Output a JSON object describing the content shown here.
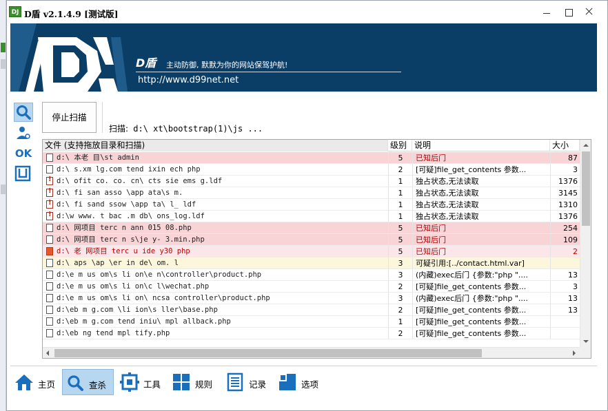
{
  "window": {
    "app_icon_text": "DJ",
    "title": "D盾 v2.1.4.9 [测试版]"
  },
  "banner": {
    "brand": "D盾",
    "slogan": "主动防御, 默默为你的网站保驾护航!",
    "url": "http://www.d99net.net"
  },
  "left_tools": {
    "ok_label": "OK"
  },
  "scan": {
    "stop_button": "停止扫描",
    "label": "扫描:",
    "path": "d:\\                      xt\\bootstrap(1)\\js ..."
  },
  "file_list": {
    "columns": {
      "file": "文件 (支持拖放目录和扫描)",
      "level": "级别",
      "desc": "说明",
      "size": "大小"
    },
    "rows": [
      {
        "style": "red",
        "icon": "file",
        "path": "d:\\   本老     目\\st         admin   ",
        "level": "5",
        "desc": "已知后门",
        "size": "87"
      },
      {
        "style": "white",
        "icon": "file",
        "path": "d:\\   s.xm      lg.com  tend   ixin  ech  php",
        "level": "2",
        "desc": "[可疑]file_get_contents 参数...",
        "size": "3"
      },
      {
        "style": "white",
        "icon": "warn",
        "path": "d:\\   ofit   co.  co.  cn\\  cts  sie   ems   g.ldf",
        "level": "1",
        "desc": "独占状态,无法读取",
        "size": "1376"
      },
      {
        "style": "white",
        "icon": "warn",
        "path": "d:\\   fi   san    asso  \\app   ata\\s  m.",
        "level": "1",
        "desc": "独占状态,无法读取",
        "size": "3145"
      },
      {
        "style": "white",
        "icon": "warn",
        "path": "d:\\   fi   sand   ssow  \\app   ta\\    l_   ldf",
        "level": "1",
        "desc": "独占状态,无法读取",
        "size": "1310"
      },
      {
        "style": "white",
        "icon": "warn",
        "path": "d:\\w      www. t   bac  .m   db\\    ons_log.ldf",
        "level": "1",
        "desc": "独占状态,无法读取",
        "size": "1376"
      },
      {
        "style": "red",
        "icon": "file",
        "path": "d:\\   网项目   terc    n   ann   015   08.php",
        "level": "5",
        "desc": "已知后门",
        "size": "254"
      },
      {
        "style": "red",
        "icon": "file",
        "path": "d:\\   网项目   terc    n  s\\je   y-   3.min.php",
        "level": "5",
        "desc": "已知后门",
        "size": "109"
      },
      {
        "style": "selred",
        "icon": "hot",
        "path": "d:\\   老   网项目   terc   u  ide   y30  php",
        "level": "5",
        "desc": "已知后门",
        "size": "2"
      },
      {
        "style": "yellow",
        "icon": "file",
        "path": "d:\\    aps   \\ap   \\er    in   de\\   om.  l",
        "level": "3",
        "desc": "可疑引用:[../contact.html.var]",
        "size": ""
      },
      {
        "style": "white",
        "icon": "file",
        "path": "d:\\e   m     us    om\\s    li    on\\e   n\\controller\\product.php",
        "level": "3",
        "desc": "(内藏)exec后门 {参数:\"php \"....",
        "size": "13"
      },
      {
        "style": "white",
        "icon": "file",
        "path": "d:\\e   m     us    om\\s    li    on\\c     l\\wechat.php",
        "level": "2",
        "desc": "[可疑]file_get_contents 参数...",
        "size": "3"
      },
      {
        "style": "white",
        "icon": "file",
        "path": "d:\\e   m     us    om\\s    li    on\\   ncsa  controller\\product.php",
        "level": "3",
        "desc": "(内藏)exec后门 {参数:\"php \"....",
        "size": "13"
      },
      {
        "style": "white",
        "icon": "file",
        "path": "d:\\eb    m     g.com  \\li   ion\\s     ller\\base.php",
        "level": "2",
        "desc": "[可疑]file_get_contents 参数...",
        "size": "13"
      },
      {
        "style": "white",
        "icon": "file",
        "path": "d:\\eb    m     g.com  tend   iniu\\   mpl   allback.php",
        "level": "1",
        "desc": "[可疑]file_get_contents 参数...",
        "size": ""
      },
      {
        "style": "white",
        "icon": "file",
        "path": "d:\\eb     ng     tend        mpl   tify.php",
        "level": "2",
        "desc": "[可疑]file_get_contents 参数...",
        "size": ""
      }
    ]
  },
  "bottom_nav": {
    "home": "主页",
    "scan": "查杀",
    "tools": "工具",
    "rules": "规则",
    "log": "记录",
    "options": "选项"
  },
  "colors": {
    "banner_bg": "#0b3e66",
    "known_backdoor_row": "#f8d4d7",
    "suspicious_ref_row": "#fcf7dc",
    "selected_nav": "#b7d6ef",
    "accent_blue": "#1a6fbd"
  }
}
